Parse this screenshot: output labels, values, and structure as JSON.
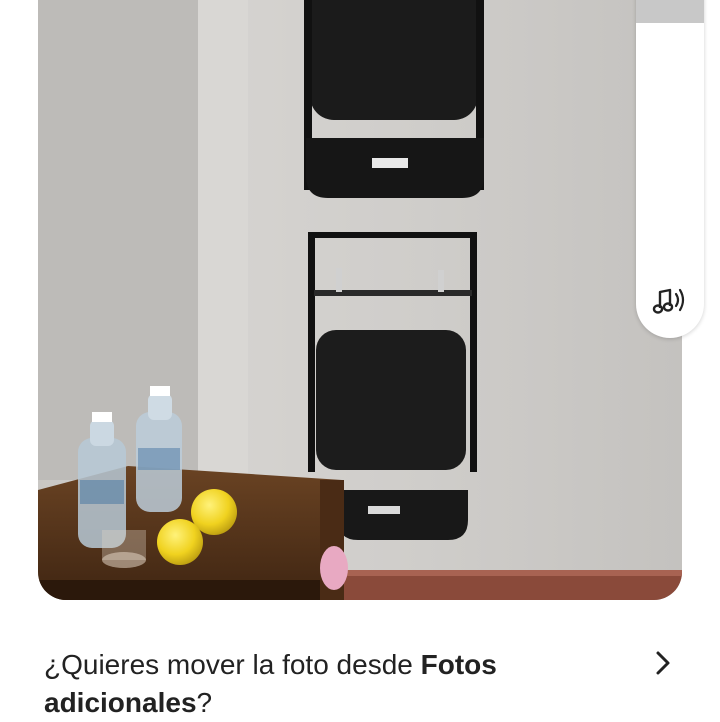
{
  "prompt": {
    "text_prefix": "¿Quieres mover la foto desde ",
    "text_bold": "Fotos adicionales",
    "text_suffix": "?"
  },
  "icons": {
    "sound": "music-volume-icon",
    "next": "chevron-right-icon"
  },
  "volume": {
    "level_percent": 12
  },
  "colors": {
    "text": "#222222",
    "volume_fill": "#c8c8c8",
    "card_bg": "#ffffff"
  }
}
